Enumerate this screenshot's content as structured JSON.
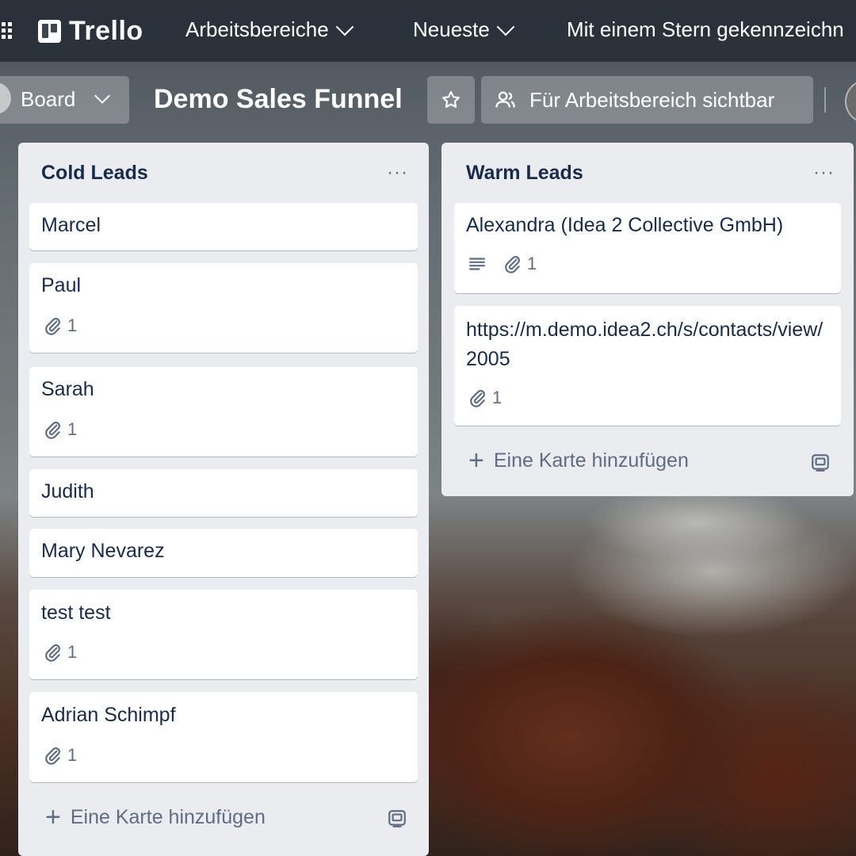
{
  "nav": {
    "app_name": "Trello",
    "workspaces": "Arbeitsbereiche",
    "recent": "Neueste",
    "starred": "Mit einem Stern gekennzeichn"
  },
  "board_header": {
    "view_label": "Board",
    "title": "Demo Sales Funnel",
    "visibility": "Für Arbeitsbereich sichtbar"
  },
  "lists": [
    {
      "title": "Cold Leads",
      "menu": "···",
      "add_card": "Eine Karte hinzufügen",
      "cards": [
        {
          "title": "Marcel"
        },
        {
          "title": "Paul",
          "attachments": "1"
        },
        {
          "title": "Sarah",
          "attachments": "1"
        },
        {
          "title": "Judith"
        },
        {
          "title": "Mary Nevarez"
        },
        {
          "title": "test test",
          "attachments": "1"
        },
        {
          "title": "Adrian Schimpf",
          "attachments": "1"
        }
      ]
    },
    {
      "title": "Warm Leads",
      "menu": "···",
      "add_card": "Eine Karte hinzufügen",
      "cards": [
        {
          "title": "Alexandra (Idea 2 Collective GmbH)",
          "description": true,
          "attachments": "1"
        },
        {
          "title": "https://m.demo.idea2.ch/s/contacts/view/2005",
          "attachments": "1"
        }
      ]
    }
  ],
  "icons": {
    "apps": "apps-grid-icon",
    "star": "star-icon",
    "visibility": "workspace-members-icon",
    "attachment": "paperclip-icon",
    "description": "description-lines-icon",
    "template": "card-template-icon"
  },
  "colors": {
    "nav_bg": "#232a32",
    "list_bg": "#ebecf0",
    "text": "#172b4d",
    "muted": "#5e6c84"
  }
}
